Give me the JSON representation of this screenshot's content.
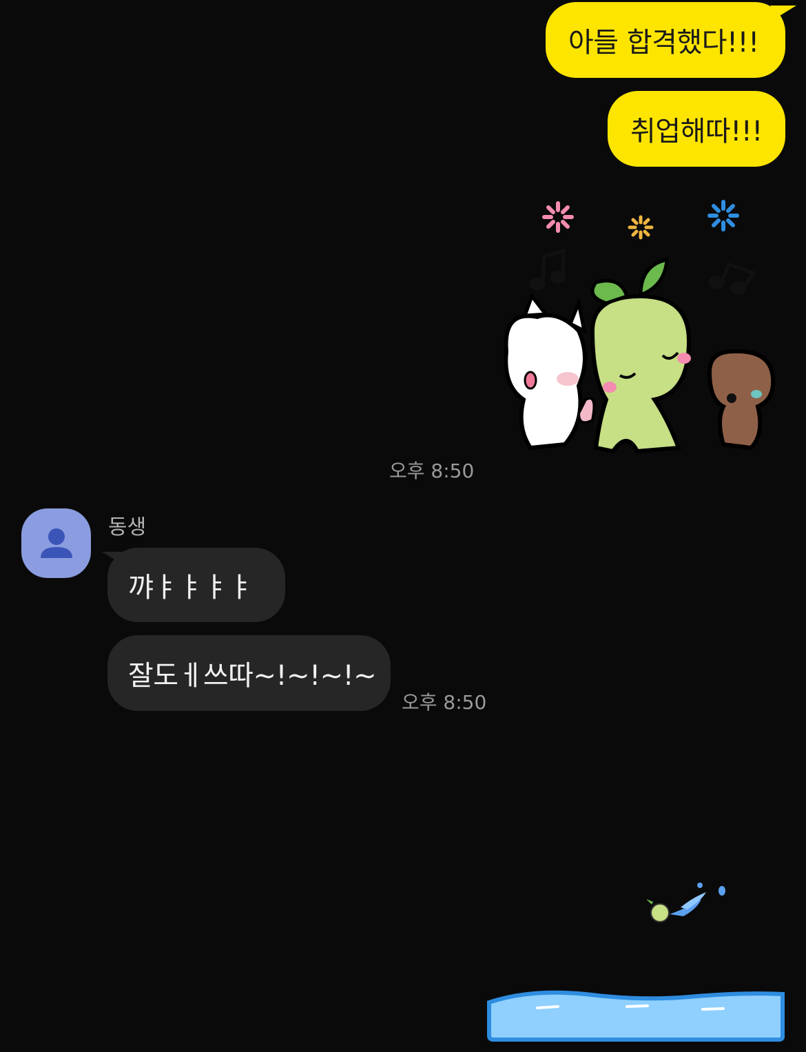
{
  "messages": {
    "me1": "아들 합격했다!!!",
    "me2": "취업해따!!!",
    "me_time": "오후 8:50",
    "sender_name": "동생",
    "other1": "꺄ㅑㅑㅑㅑ",
    "other2": "잘도ㅔ쓰따~!~!~!~",
    "other_time": "오후 8:50"
  },
  "colors": {
    "my_bubble": "#fee500",
    "other_bubble": "#262626",
    "avatar": "#8b9de0",
    "background": "#0a0a0a"
  },
  "icons": {
    "avatar": "person-icon",
    "sticker_main": "dancing-characters-sticker",
    "sticker_anim": "splash-sticker"
  }
}
